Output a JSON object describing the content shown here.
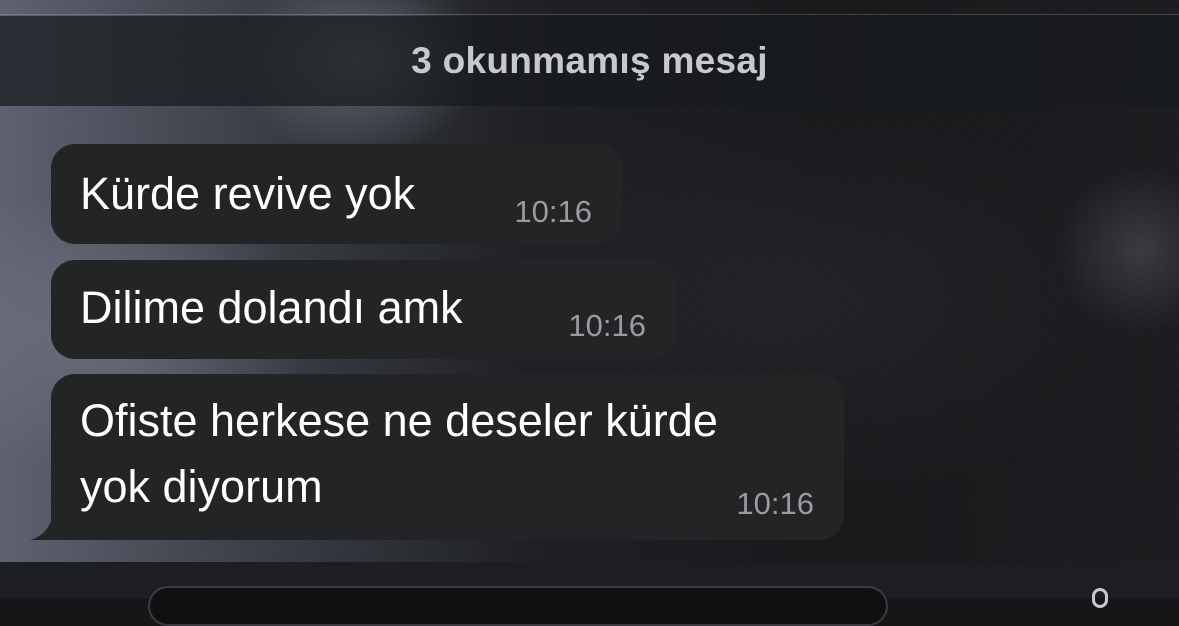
{
  "unread_banner": {
    "text": "3 okunmamış mesaj"
  },
  "messages": [
    {
      "text": "Kürde revive yok",
      "time": "10:16"
    },
    {
      "text": "Dilime dolandı amk",
      "time": "10:16"
    },
    {
      "text_line1": "Ofiste herkese ne deseler kürde",
      "text_line2": "yok diyorum",
      "time": "10:16"
    }
  ],
  "composer": {
    "icon": "microphone-icon"
  },
  "colors": {
    "bubble": "#232426",
    "timestamp": "#9a9b9e",
    "banner_text": "#c8c9cc"
  }
}
